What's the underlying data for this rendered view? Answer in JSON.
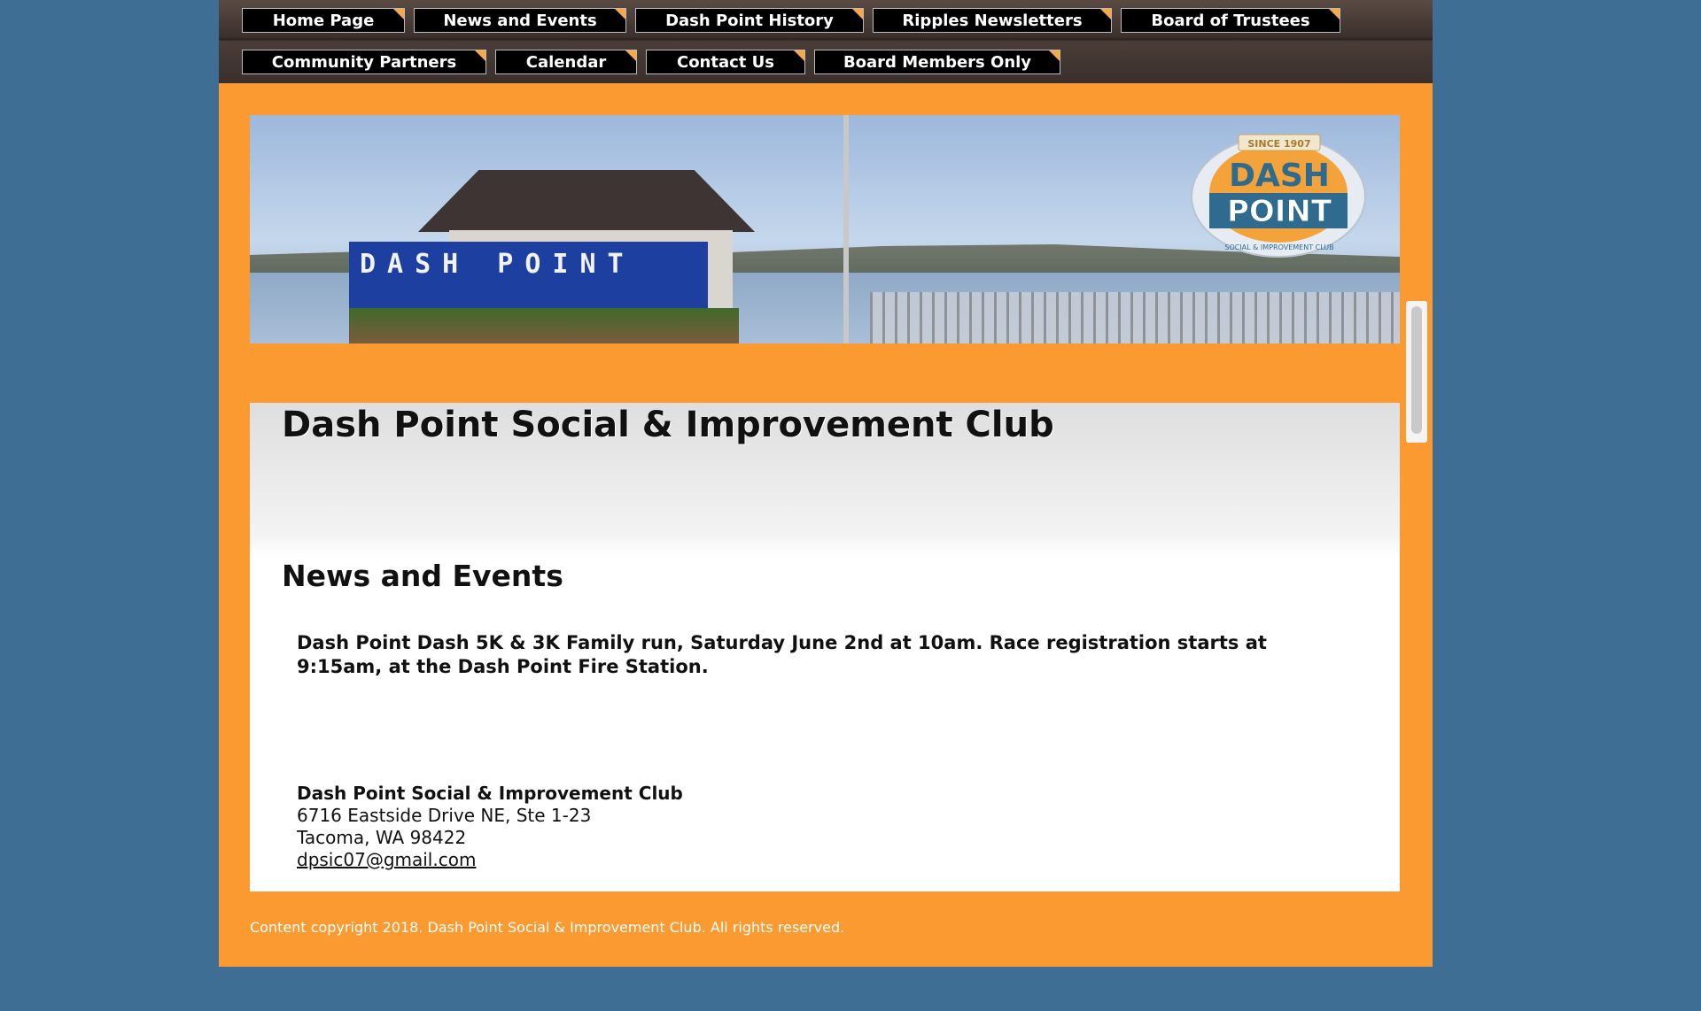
{
  "nav": {
    "row1": [
      "Home Page",
      "News and Events",
      "Dash Point History",
      "Ripples Newsletters",
      "Board of Trustees"
    ],
    "row2": [
      "Community Partners",
      "Calendar",
      "Contact Us",
      "Board Members Only"
    ]
  },
  "banner": {
    "sign_text": "DASH POINT",
    "logo": {
      "since": "SINCE 1907",
      "line1": "DASH",
      "line2": "POINT",
      "ring": "SOCIAL & IMPROVEMENT CLUB"
    }
  },
  "main": {
    "site_title": "Dash Point Social & Improvement Club",
    "section_title": "News and Events",
    "event_text": "Dash Point Dash 5K & 3K Family run, Saturday June 2nd at 10am.  Race registration starts at 9:15am, at the Dash Point Fire Station.",
    "address": {
      "org": "Dash Point Social & Improvement Club",
      "street": "6716 Eastside Drive NE, Ste 1-23",
      "city": "Tacoma, WA  98422",
      "email": "dpsic07@gmail.com"
    }
  },
  "footer": {
    "text": "Content copyright 2018. Dash Point Social & Improvement Club. All rights reserved."
  },
  "colors": {
    "background": "#3e6e94",
    "page": "#fb9a30",
    "nav_button": "#000000",
    "accent": "#f7a94a"
  }
}
